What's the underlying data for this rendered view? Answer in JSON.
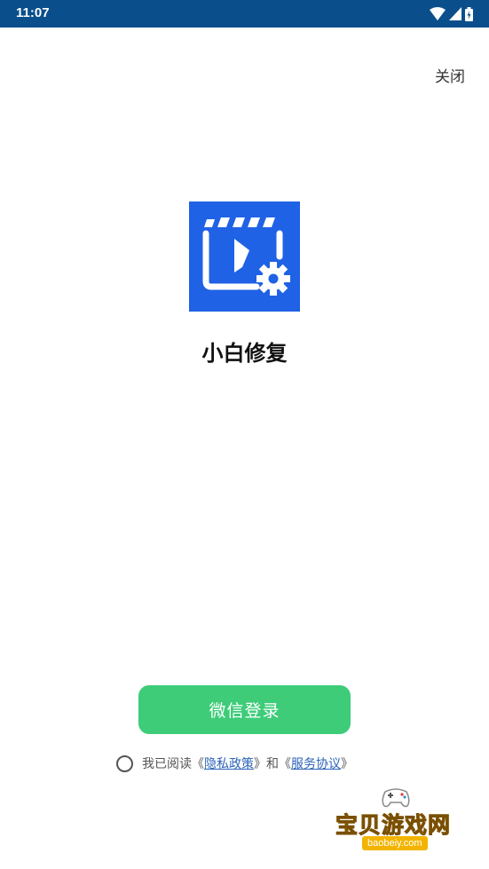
{
  "status_bar": {
    "time": "11:07"
  },
  "header": {
    "close_label": "关闭"
  },
  "app": {
    "name": "小白修复",
    "logo_color": "#1f62e5"
  },
  "login": {
    "button_label": "微信登录",
    "button_color": "#3ecc79"
  },
  "agreement": {
    "prefix": "我已阅读",
    "open_quote": "《",
    "close_quote": "》",
    "privacy_link": "隐私政策",
    "connector": "和",
    "terms_link": "服务协议"
  },
  "watermark": {
    "title": "宝贝游戏网",
    "url": "baobeiy.com"
  }
}
